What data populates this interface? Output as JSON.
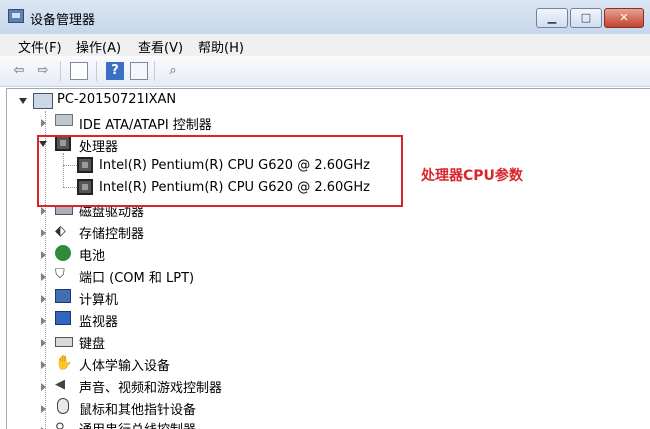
{
  "window": {
    "title": "设备管理器",
    "minimize_label": "▁",
    "maximize_label": "□",
    "close_label": "✕"
  },
  "menu": [
    "文件(F)",
    "操作(A)",
    "查看(V)",
    "帮助(H)"
  ],
  "toolbar": {
    "back_icon": "back-arrow-icon",
    "forward_icon": "forward-arrow-icon",
    "help_label": "?"
  },
  "tree": {
    "computer": "PC-20150721IXAN",
    "ide": "IDE ATA/ATAPI 控制器",
    "processor": "处理器",
    "cpu1": "Intel(R) Pentium(R) CPU G620 @ 2.60GHz",
    "cpu2": "Intel(R) Pentium(R) CPU G620 @ 2.60GHz",
    "disk": "磁盘驱动器",
    "storage": "存储控制器",
    "battery": "电池",
    "ports": "端口 (COM 和 LPT)",
    "computer_node": "计算机",
    "monitors": "监视器",
    "keyboard": "键盘",
    "hid": "人体学输入设备",
    "sound": "声音、视频和游戏控制器",
    "mice": "鼠标和其他指针设备",
    "usb": "通用串行总线控制器"
  },
  "annotation": "处理器CPU参数",
  "colors": {
    "annotation": "#d9252c"
  }
}
